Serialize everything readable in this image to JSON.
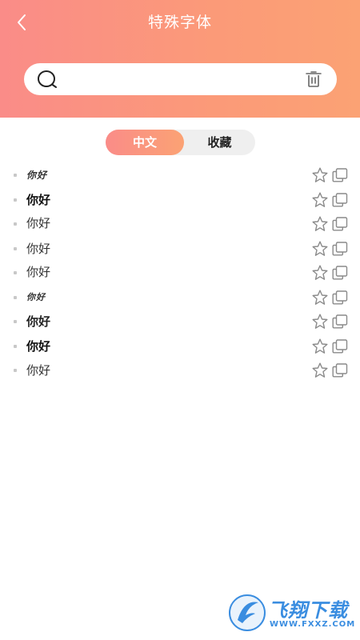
{
  "header": {
    "title": "特殊字体",
    "background_gradient": [
      "#fa8c88",
      "#fba274"
    ],
    "back_icon": "chevron-left-icon"
  },
  "search": {
    "value": "",
    "placeholder": "",
    "search_icon": "search-icon",
    "clear_icon": "trash-icon"
  },
  "tabs": [
    {
      "label": "中文",
      "active": true
    },
    {
      "label": "收藏",
      "active": false
    }
  ],
  "list": {
    "items": [
      {
        "text": "你好",
        "style": "f0"
      },
      {
        "text": "你好",
        "style": "f1"
      },
      {
        "text": "你好",
        "style": "f2"
      },
      {
        "text": "你好",
        "style": "f3"
      },
      {
        "text": "你好",
        "style": "f4"
      },
      {
        "text": "你好",
        "style": "f5"
      },
      {
        "text": "你好",
        "style": "f6"
      },
      {
        "text": "你好",
        "style": "f7"
      },
      {
        "text": "你好",
        "style": "f8"
      }
    ],
    "favorite_icon": "star-outline-icon",
    "copy_icon": "copy-icon"
  },
  "watermark": {
    "title": "飞翔下载",
    "url": "WWW.FXXZ.COM",
    "color": "#3a8de0"
  }
}
